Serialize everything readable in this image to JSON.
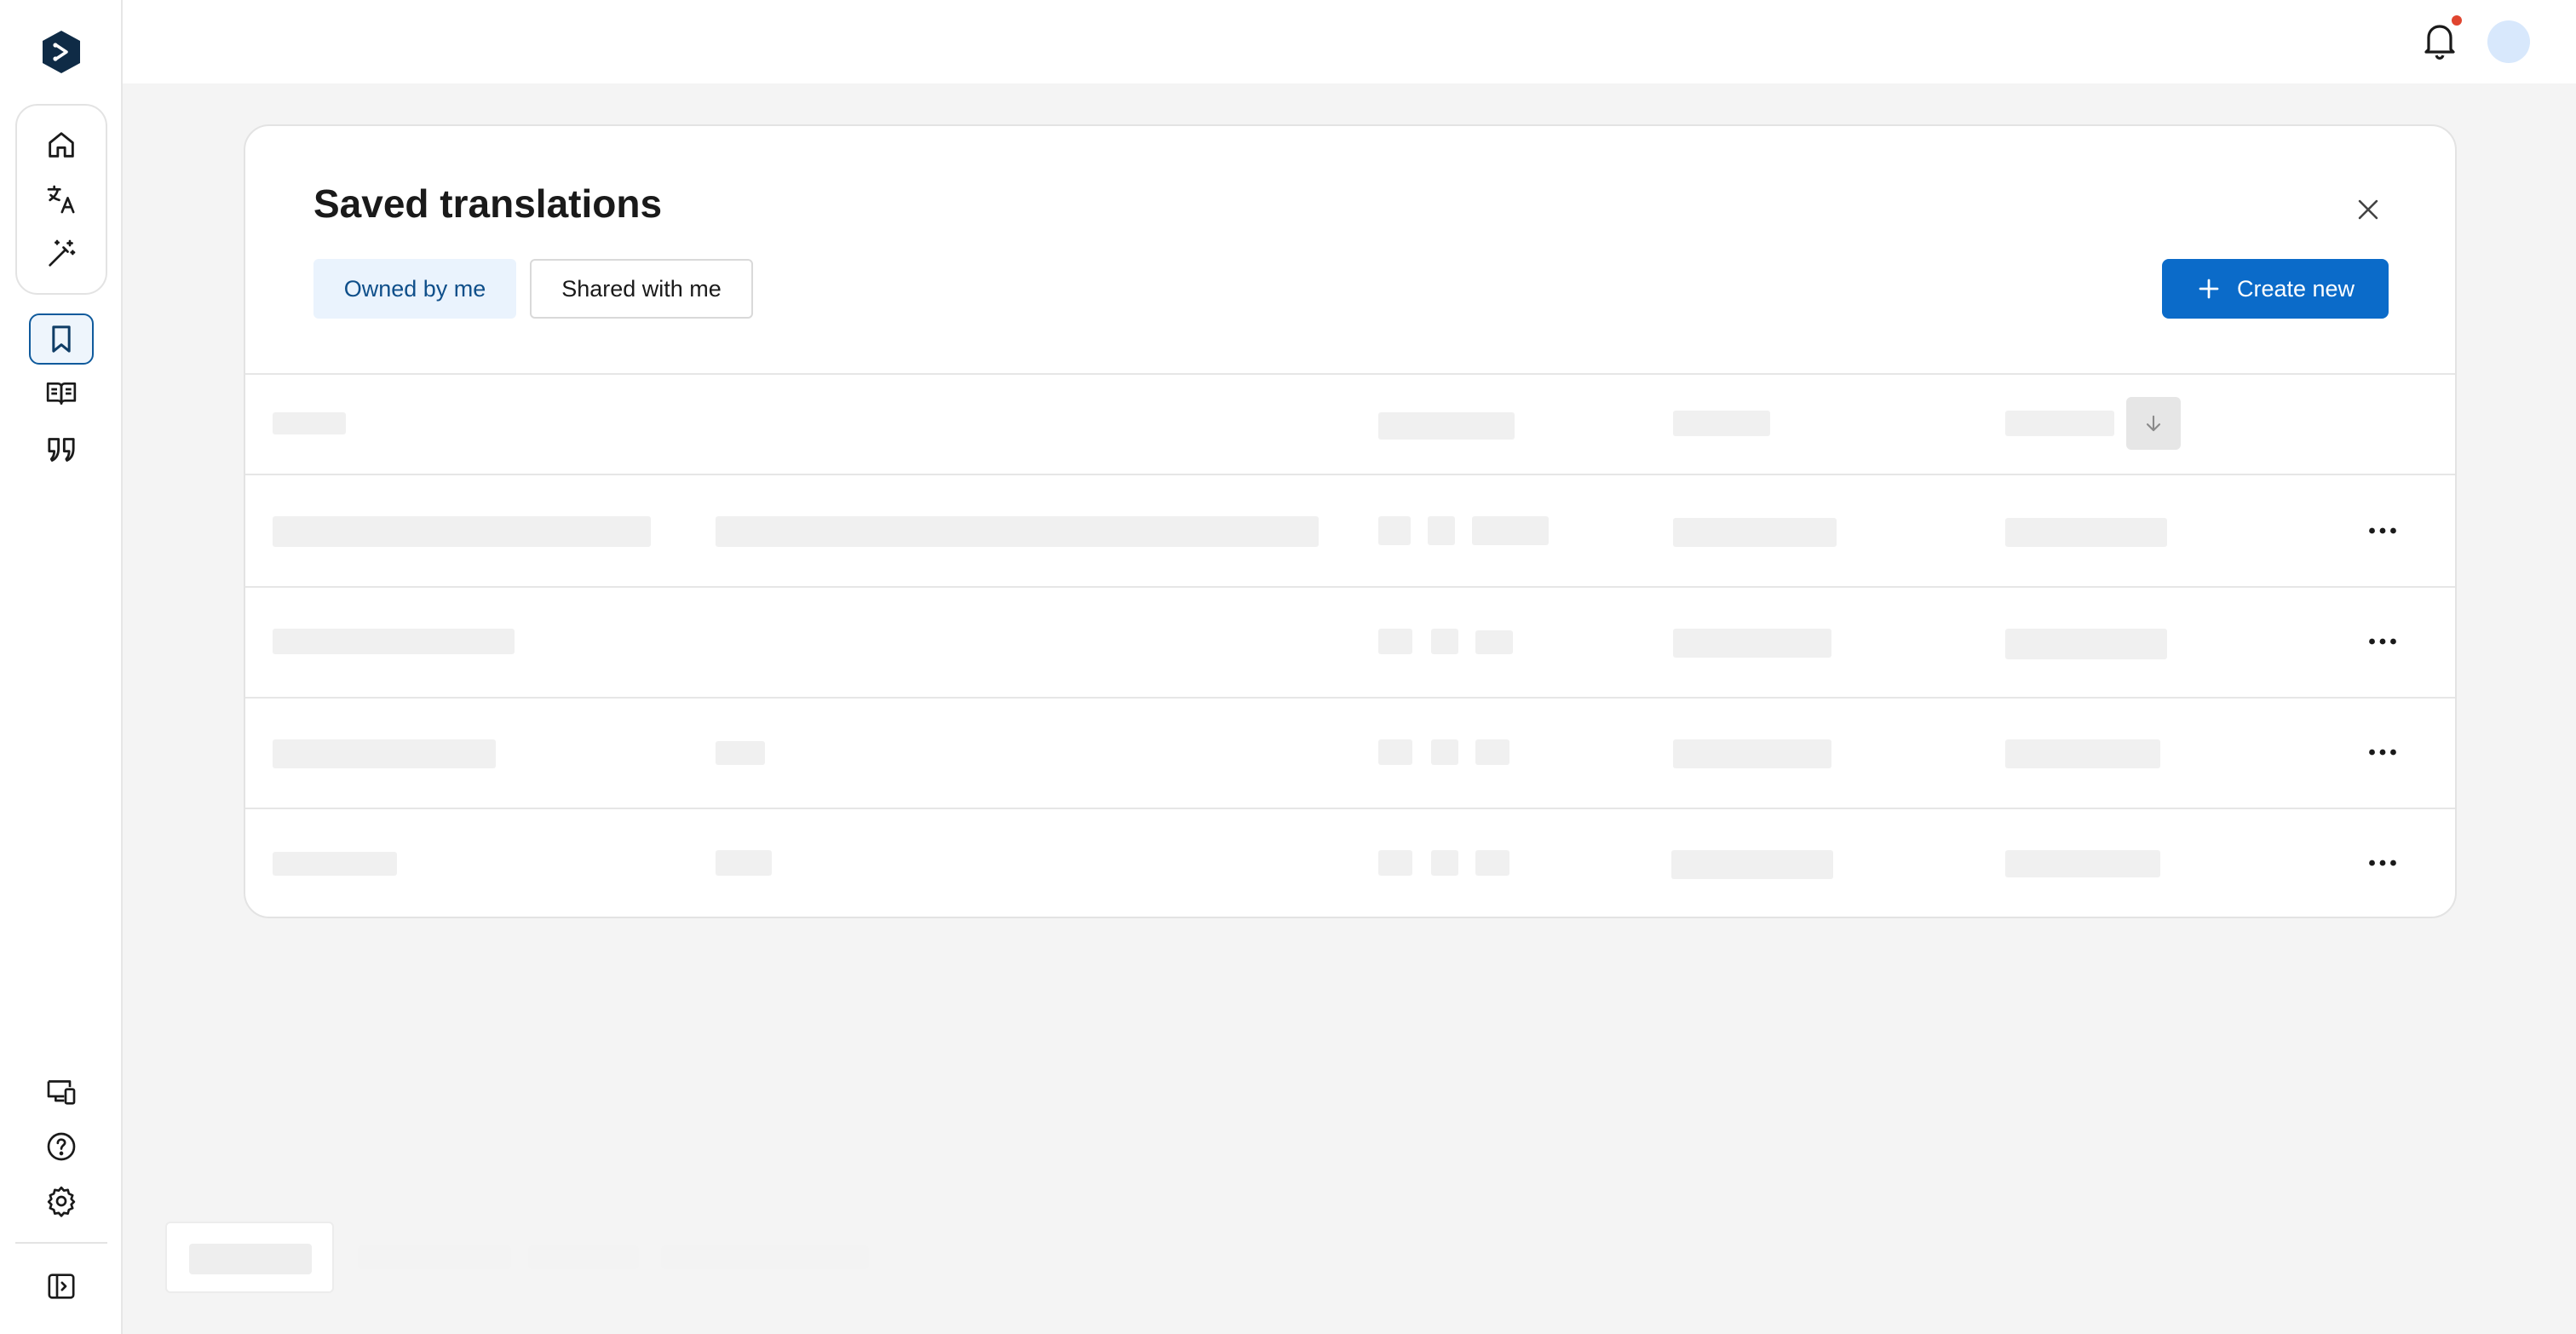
{
  "sidebar": {
    "logo": "deepl-logo",
    "items": [
      {
        "name": "home",
        "icon": "home-icon"
      },
      {
        "name": "translate",
        "icon": "translate-icon"
      },
      {
        "name": "write",
        "icon": "magic-wand-icon"
      },
      {
        "name": "saved",
        "icon": "bookmark-icon",
        "active": true
      },
      {
        "name": "glossary",
        "icon": "book-icon"
      },
      {
        "name": "styles",
        "icon": "quote-icon"
      }
    ],
    "bottom_items": [
      {
        "name": "devices",
        "icon": "devices-icon"
      },
      {
        "name": "help",
        "icon": "help-icon"
      },
      {
        "name": "settings",
        "icon": "gear-icon"
      },
      {
        "name": "collapse",
        "icon": "sidebar-toggle-icon"
      }
    ]
  },
  "topbar": {
    "notification_icon": "bell-icon",
    "has_notification": true,
    "avatar": "avatar"
  },
  "panel": {
    "title": "Saved translations",
    "tabs": [
      {
        "label": "Owned by me",
        "selected": true
      },
      {
        "label": "Shared with me",
        "selected": false
      }
    ],
    "create_label": "Create new",
    "sort_icon": "arrow-down-icon",
    "row_count": 4,
    "row_action_icon": "more-horizontal-icon",
    "loading": true
  },
  "colors": {
    "accent": "#0b6bc9",
    "selected_tab_bg": "#eaf3fd",
    "selected_tab_text": "#0f4f8a",
    "skeleton": "#f0f0f0",
    "notification_dot": "#e0452f",
    "background": "#f4f4f4"
  }
}
